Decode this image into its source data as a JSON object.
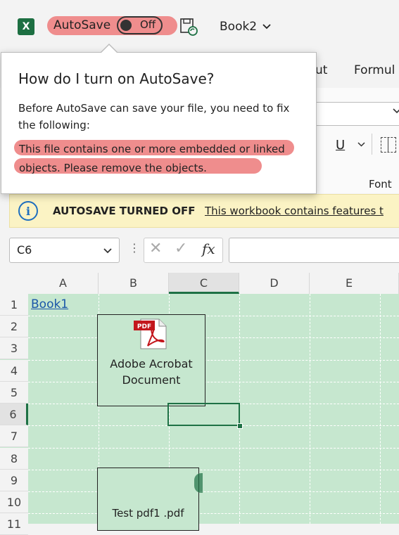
{
  "titlebar": {
    "app_icon": "excel-logo-icon",
    "app_letter": "X",
    "autosave_label": "AutoSave",
    "autosave_state": "Off",
    "save_icon": "save-sync-icon",
    "workbook_name": "Book2",
    "dropdown_icon": "chevron-down-icon"
  },
  "ribbon": {
    "tabs": [
      {
        "label": "ut"
      },
      {
        "label": "Formul"
      }
    ],
    "underline_label": "U",
    "group_label": "Font"
  },
  "popup": {
    "title": "How do I turn on AutoSave?",
    "body": "Before AutoSave can save your file, you need to fix the following:",
    "error": "This file contains one or more embedded or linked objects. Please remove the objects."
  },
  "infobar": {
    "icon": "info-icon",
    "icon_glyph": "i",
    "title": "AUTOSAVE TURNED OFF",
    "link": "This workbook contains features t"
  },
  "formula_bar": {
    "name_box": "C6",
    "dots": "⋮",
    "cancel": "✕",
    "enter": "✓",
    "fx": "fx",
    "value": ""
  },
  "sheet": {
    "columns": [
      "A",
      "B",
      "C",
      "D",
      "E"
    ],
    "rows": [
      "1",
      "2",
      "3",
      "4",
      "5",
      "6",
      "7",
      "8",
      "9",
      "10",
      "11"
    ],
    "selected_column": "C",
    "selected_row": "6",
    "cell_a1": "Book1",
    "objects": [
      {
        "type": "pdf-icon",
        "badge": "PDF",
        "label": "Adobe Acrobat Document"
      },
      {
        "label": "Test pdf1 .pdf"
      }
    ]
  },
  "colors": {
    "accent_green": "#1e7145",
    "highlight_red": "#ef8d8d",
    "infobar_yellow": "#fbf3c4",
    "grid_green": "#c6e7cf",
    "link_blue": "#1a56a8"
  }
}
